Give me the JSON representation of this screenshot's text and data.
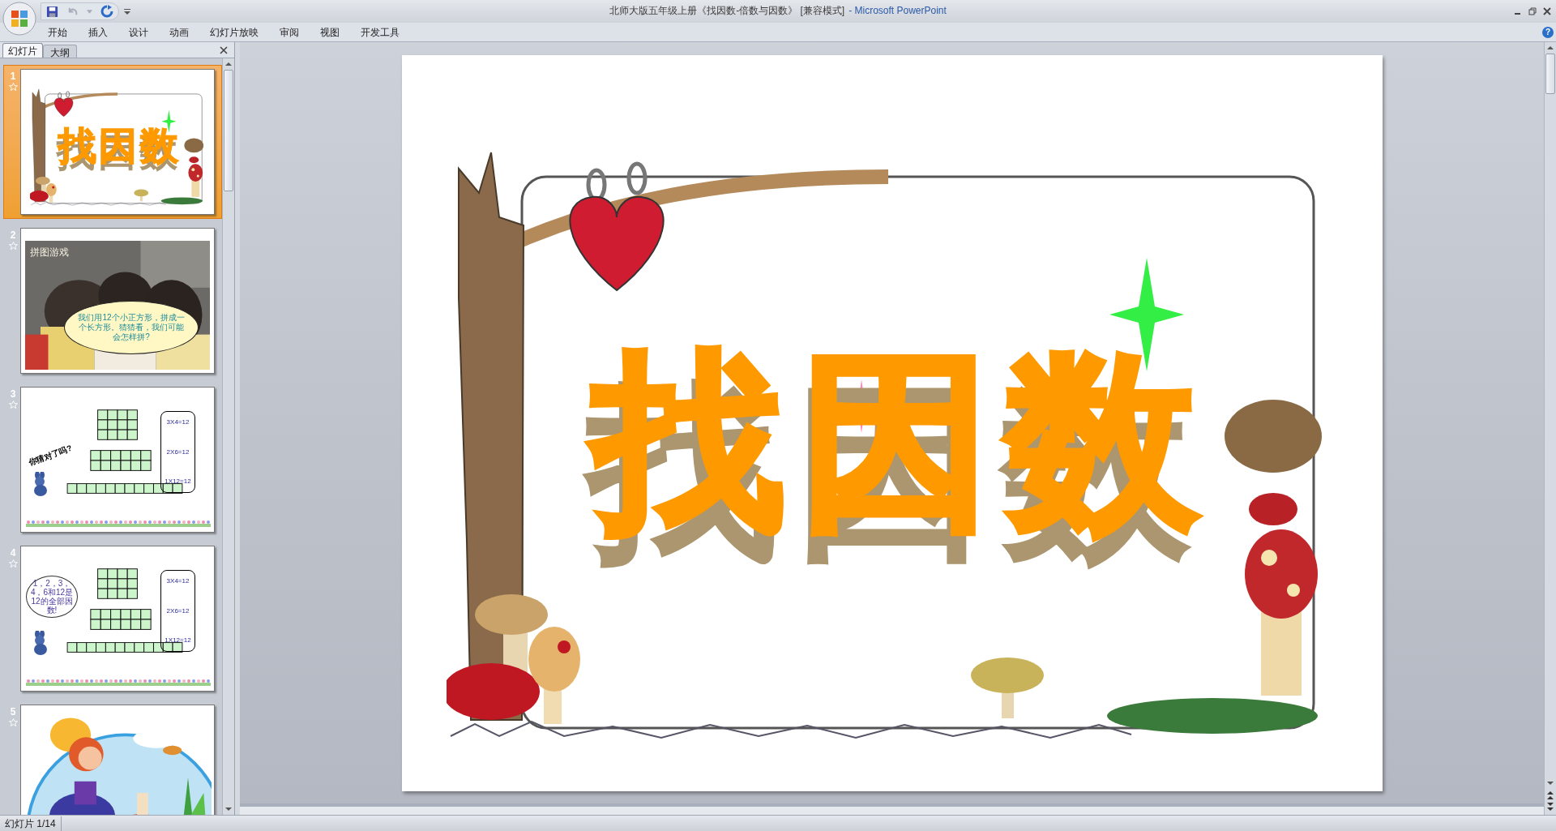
{
  "window": {
    "title": "北师大版五年级上册《找因数-倍数与因数》 [兼容模式]",
    "app_name": "- Microsoft PowerPoint"
  },
  "ribbon_tabs": [
    "开始",
    "插入",
    "设计",
    "动画",
    "幻灯片放映",
    "审阅",
    "视图",
    "开发工具"
  ],
  "help_button": "?",
  "pane_tabs": [
    {
      "label": "幻灯片",
      "selected": true
    },
    {
      "label": "大纲",
      "selected": false
    }
  ],
  "thumbnails": [
    {
      "number": "1",
      "selected": true,
      "kind": "title",
      "title": "找因数"
    },
    {
      "number": "2",
      "selected": false,
      "heading": "拼图游戏",
      "bubble": "我们用12个小正方形，拼成一个长方形。猜猜看，我们可能会怎样拼?"
    },
    {
      "number": "3",
      "selected": false,
      "kind": "grids",
      "caption": "你猜对了吗?",
      "equations": [
        "3X4=12",
        "2X6=12",
        "1X12=12"
      ]
    },
    {
      "number": "4",
      "selected": false,
      "kind": "grids",
      "thought": "1，2，3，4，6和12是12的全部因数!",
      "equations": [
        "3X4=12",
        "2X6=12",
        "1X12=12"
      ]
    },
    {
      "number": "5",
      "selected": false,
      "kind": "picture"
    }
  ],
  "slide": {
    "title": "找因数"
  },
  "status_bar": {
    "slide_indicator": "幻灯片 1/14"
  }
}
